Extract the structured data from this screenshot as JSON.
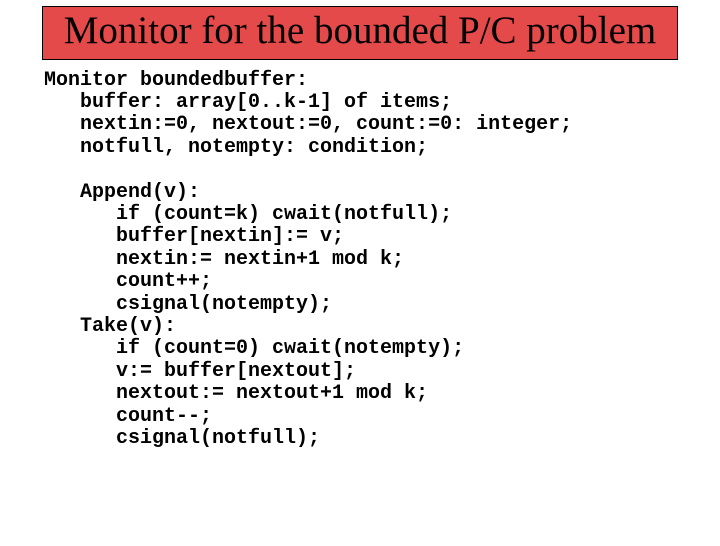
{
  "title": "Monitor for the bounded P/C problem",
  "code": {
    "l01": "Monitor boundedbuffer:",
    "l02": "   buffer: array[0..k-1] of items;",
    "l03": "   nextin:=0, nextout:=0, count:=0: integer;",
    "l04": "   notfull, notempty: condition;",
    "l05": "",
    "l06": "   Append(v):",
    "l07": "      if (count=k) cwait(notfull);",
    "l08": "      buffer[nextin]:= v;",
    "l09": "      nextin:= nextin+1 mod k;",
    "l10": "      count++;",
    "l11": "      csignal(notempty);",
    "l12": "   Take(v):",
    "l13": "      if (count=0) cwait(notempty);",
    "l14": "      v:= buffer[nextout];",
    "l15": "      nextout:= nextout+1 mod k;",
    "l16": "      count--;",
    "l17": "      csignal(notfull);"
  }
}
